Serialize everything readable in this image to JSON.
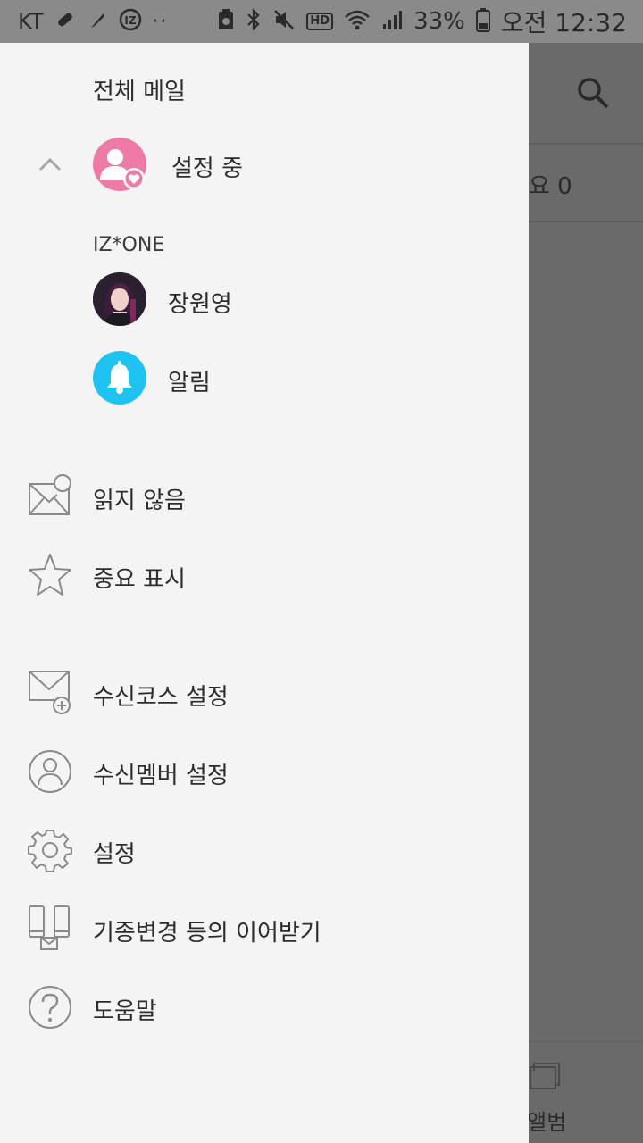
{
  "status_bar": {
    "carrier": "KT",
    "dots": "··",
    "hd": "HD",
    "battery_pct": "33%",
    "time": "오전 12:32"
  },
  "background": {
    "row_text": "요 0",
    "bottom_label": "앨범"
  },
  "drawer": {
    "all_mail": "전체 메일",
    "account_name": "설정 중",
    "group_label": "IZ*ONE",
    "members": [
      {
        "name": "장원영"
      },
      {
        "name": "알림"
      }
    ],
    "filters": [
      {
        "label": "읽지 않음",
        "icon": "unread-mail-icon"
      },
      {
        "label": "중요 표시",
        "icon": "star-icon"
      }
    ],
    "settings": [
      {
        "label": "수신코스 설정",
        "icon": "mail-plus-icon"
      },
      {
        "label": "수신멤버 설정",
        "icon": "person-circle-icon"
      },
      {
        "label": "설정",
        "icon": "gear-icon"
      },
      {
        "label": "기종변경 등의 이어받기",
        "icon": "device-transfer-icon"
      },
      {
        "label": "도움말",
        "icon": "help-icon"
      }
    ]
  },
  "colors": {
    "drawer_bg": "#f4f4f4",
    "scrim": "#6a6a6a",
    "account_avatar": "#ee7aa8",
    "bell_avatar": "#1ec3f2",
    "icon_stroke": "#8a8a8a"
  }
}
